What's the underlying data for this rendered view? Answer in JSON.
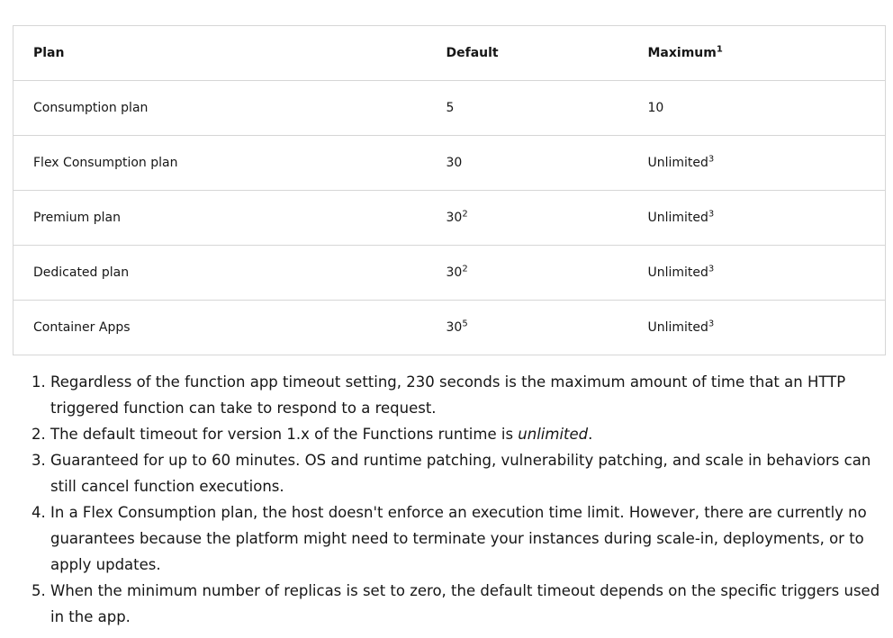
{
  "table": {
    "headers": {
      "plan": "Plan",
      "default": "Default",
      "maximum": "Maximum",
      "maximum_sup": "1"
    },
    "rows": [
      {
        "plan": "Consumption plan",
        "default": "5",
        "default_sup": "",
        "maximum": "10",
        "maximum_sup": ""
      },
      {
        "plan": "Flex Consumption plan",
        "default": "30",
        "default_sup": "",
        "maximum": "Unlimited",
        "maximum_sup": "3"
      },
      {
        "plan": "Premium plan",
        "default": "30",
        "default_sup": "2",
        "maximum": "Unlimited",
        "maximum_sup": "3"
      },
      {
        "plan": "Dedicated plan",
        "default": "30",
        "default_sup": "2",
        "maximum": "Unlimited",
        "maximum_sup": "3"
      },
      {
        "plan": "Container Apps",
        "default": "30",
        "default_sup": "5",
        "maximum": "Unlimited",
        "maximum_sup": "3"
      }
    ]
  },
  "footnotes": {
    "n1": "Regardless of the function app timeout setting, 230 seconds is the maximum amount of time that an HTTP triggered function can take to respond to a request.",
    "n2_before": "The default timeout for version 1.x of the Functions runtime is ",
    "n2_em": "unlimited",
    "n2_after": ".",
    "n3": "Guaranteed for up to 60 minutes. OS and runtime patching, vulnerability patching, and scale in behaviors can still cancel function executions.",
    "n4": "In a Flex Consumption plan, the host doesn't enforce an execution time limit. However, there are currently no guarantees because the platform might need to terminate your instances during scale-in, deployments, or to apply updates.",
    "n5": "When the minimum number of replicas is set to zero, the default timeout depends on the specific triggers used in the app."
  }
}
